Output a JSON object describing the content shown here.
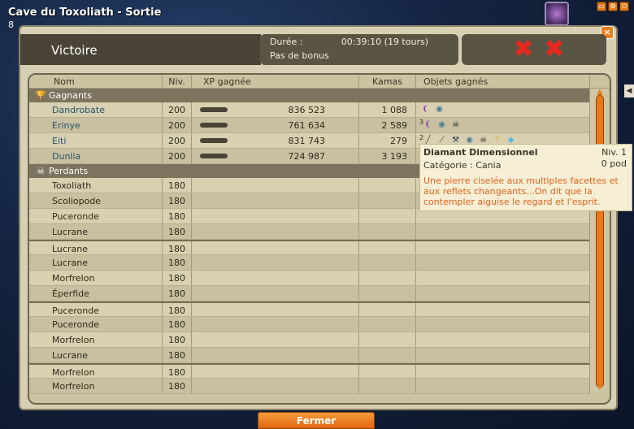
{
  "game": {
    "title": "Cave du Toxoliath - Sortie",
    "title_line2": "8"
  },
  "window": {
    "victory_label": "Victoire",
    "duration_label": "Durée :",
    "duration_value": "00:39:10 (19 tours)",
    "bonus_text": "Pas de bonus",
    "close_symbol": "×"
  },
  "columns": {
    "nom": "Nom",
    "niv": "Niv.",
    "xp": "XP gagnée",
    "kamas": "Kamas",
    "objets": "Objets gagnés"
  },
  "sections": {
    "winners": "Gagnants",
    "losers": "Perdants"
  },
  "winners": [
    {
      "name": "Dandrobate",
      "level": "200",
      "xp": "836 523",
      "kamas": "1 088",
      "objects": [
        "purple-horn-icon",
        "orb-icon"
      ]
    },
    {
      "name": "Erinye",
      "level": "200",
      "xp": "761 634",
      "kamas": "2 589",
      "objects": [
        "purple-horn-icon",
        "orb-icon",
        "skull-icon"
      ],
      "stack_label": "3"
    },
    {
      "name": "Eiti",
      "level": "200",
      "xp": "831 743",
      "kamas": "279",
      "objects": [
        "stick-icon",
        "bow-icon",
        "pick-icon",
        "orb-icon",
        "skull-icon",
        "wand-icon",
        "crystal-icon"
      ],
      "stack_label": "2"
    },
    {
      "name": "Dunlia",
      "level": "200",
      "xp": "724 987",
      "kamas": "3 193",
      "objects": []
    }
  ],
  "losers": [
    {
      "name": "Toxoliath",
      "level": "180",
      "group_start": false
    },
    {
      "name": "Scoliopode",
      "level": "180",
      "group_start": false
    },
    {
      "name": "Puceronde",
      "level": "180",
      "group_start": false
    },
    {
      "name": "Lucrane",
      "level": "180",
      "group_start": false
    },
    {
      "name": "Lucrane",
      "level": "180",
      "group_start": true
    },
    {
      "name": "Lucrane",
      "level": "180",
      "group_start": false
    },
    {
      "name": "Morfrelon",
      "level": "180",
      "group_start": false
    },
    {
      "name": "Éperfide",
      "level": "180",
      "group_start": false
    },
    {
      "name": "Puceronde",
      "level": "180",
      "group_start": true
    },
    {
      "name": "Puceronde",
      "level": "180",
      "group_start": false
    },
    {
      "name": "Morfrelon",
      "level": "180",
      "group_start": false
    },
    {
      "name": "Lucrane",
      "level": "180",
      "group_start": false
    },
    {
      "name": "Morfrelon",
      "level": "180",
      "group_start": true
    },
    {
      "name": "Morfrelon",
      "level": "180",
      "group_start": false
    }
  ],
  "tooltip": {
    "name": "Diamant Dimensionnel",
    "level": "Niv. 1",
    "weight": "0 pod",
    "category": "Catégorie : Cania",
    "description": "Une pierre ciselée aux multiples facettes et aux reflets changeants...On dit que la contempler aiguise le regard et l'esprit."
  },
  "footer": {
    "close_button": "Fermer"
  },
  "colors": {
    "accent": "#e77918",
    "header_dark": "#4a4436",
    "winner_name": "#24536b",
    "tooltip_desc": "#e0621a"
  }
}
